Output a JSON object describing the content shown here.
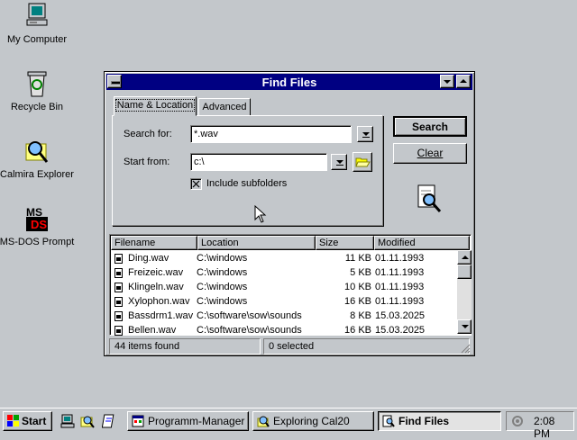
{
  "desktop": {
    "icons": [
      {
        "label": "My Computer",
        "icon": "computer-icon"
      },
      {
        "label": "Recycle Bin",
        "icon": "recycle-bin-icon"
      },
      {
        "label": "Calmira Explorer",
        "icon": "explorer-icon"
      },
      {
        "label": "MS-DOS Prompt",
        "icon": "ms-dos-icon"
      }
    ]
  },
  "window": {
    "title": "Find Files",
    "tabs": [
      "Name & Location",
      "Advanced"
    ],
    "search_for_label": "Search for:",
    "search_for_value": "*.wav",
    "start_from_label": "Start from:",
    "start_from_value": "c:\\",
    "include_subfolders_label": "Include subfolders",
    "include_subfolders_checked": true,
    "search_button": "Search",
    "clear_button": "Clear",
    "columns": [
      "Filename",
      "Location",
      "Size",
      "Modified"
    ],
    "rows": [
      {
        "name": "Ding.wav",
        "location": "C:\\windows",
        "size": "11 KB",
        "modified": "01.11.1993"
      },
      {
        "name": "Freizeic.wav",
        "location": "C:\\windows",
        "size": "5 KB",
        "modified": "01.11.1993"
      },
      {
        "name": "Klingeln.wav",
        "location": "C:\\windows",
        "size": "10 KB",
        "modified": "01.11.1993"
      },
      {
        "name": "Xylophon.wav",
        "location": "C:\\windows",
        "size": "16 KB",
        "modified": "01.11.1993"
      },
      {
        "name": "Bassdrm1.wav",
        "location": "C:\\software\\sow\\sounds",
        "size": "8 KB",
        "modified": "15.03.2025"
      },
      {
        "name": "Bellen.wav",
        "location": "C:\\software\\sow\\sounds",
        "size": "16 KB",
        "modified": "15.03.2025"
      }
    ],
    "status_found": "44 items found",
    "status_selected": "0 selected"
  },
  "taskbar": {
    "start_label": "Start",
    "tasks": [
      "Programm-Manager",
      "Exploring Cal20",
      "Find Files"
    ],
    "active_task": "Find Files",
    "clock": "2:08 PM"
  },
  "colors": {
    "desktop": "#c3c7cb",
    "titlebar": "#000082"
  }
}
